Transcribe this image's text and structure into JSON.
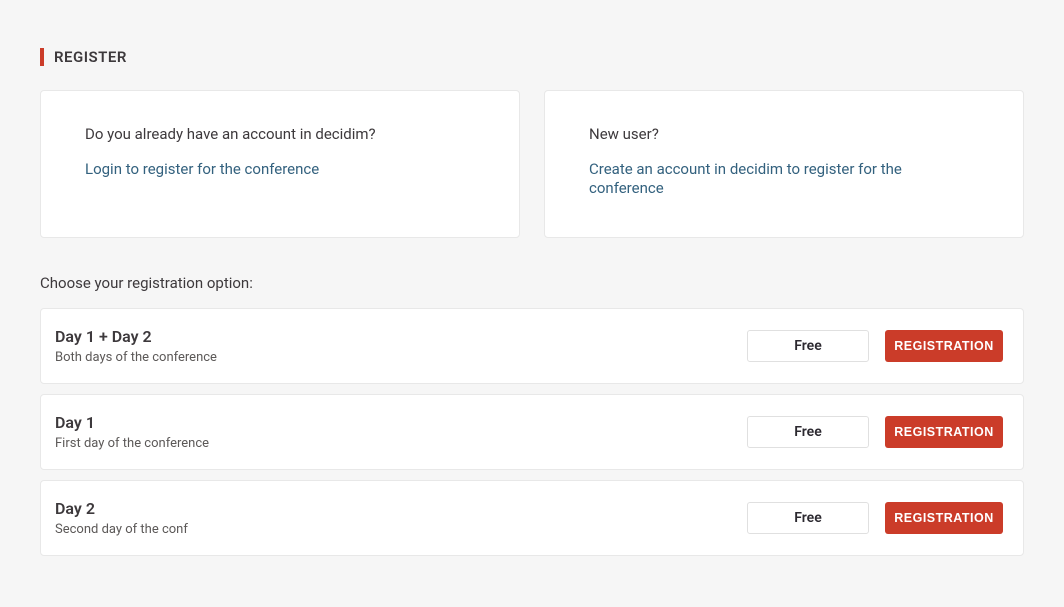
{
  "section_title": "REGISTER",
  "auth": {
    "existing": {
      "prompt": "Do you already have an account in decidim?",
      "link": "Login to register for the conference"
    },
    "new": {
      "prompt": "New user?",
      "link": "Create an account in decidim to register for the conference"
    }
  },
  "choose_label": "Choose your registration option:",
  "options": [
    {
      "title": "Day 1 + Day 2",
      "description": "Both days of the conference",
      "price": "Free",
      "button": "REGISTRATION"
    },
    {
      "title": "Day 1",
      "description": "First day of the conference",
      "price": "Free",
      "button": "REGISTRATION"
    },
    {
      "title": "Day 2",
      "description": "Second day of the conf",
      "price": "Free",
      "button": "REGISTRATION"
    }
  ]
}
